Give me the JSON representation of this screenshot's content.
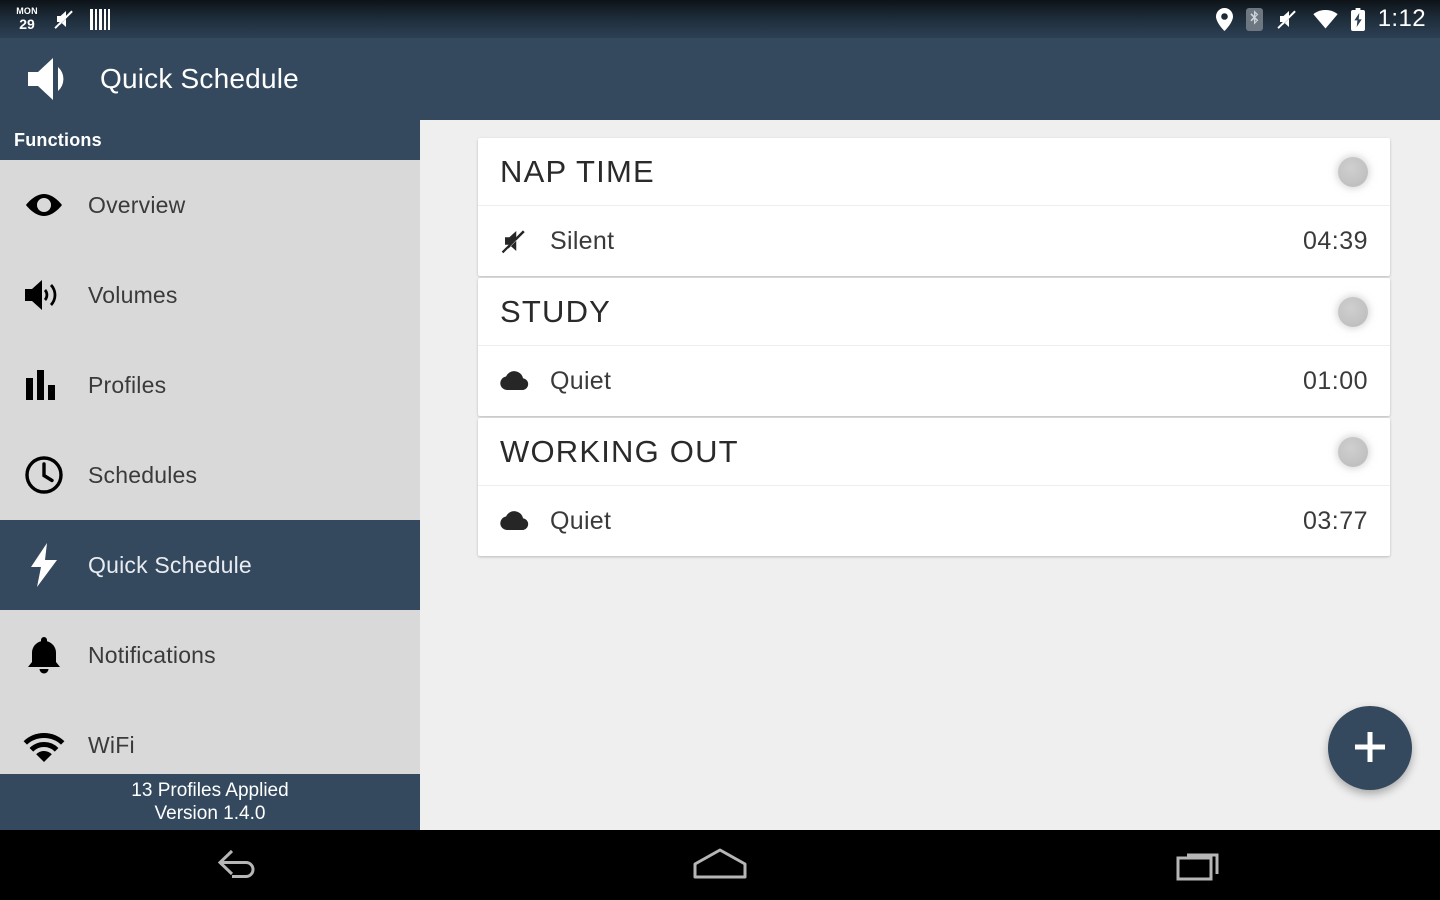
{
  "statusbar": {
    "calendar_month": "MON",
    "calendar_day": "29",
    "time": "1:12",
    "left_icons": [
      "calendar-icon",
      "volume-muted-icon",
      "barcode-icon"
    ],
    "right_icons": [
      "location-pin-icon",
      "bluetooth-icon",
      "volume-muted-icon",
      "wifi-icon",
      "battery-charging-icon"
    ]
  },
  "appbar": {
    "title": "Quick Schedule",
    "icon": "speaker-icon",
    "bg_color": "#34495e"
  },
  "sidebar": {
    "header": "Functions",
    "items": [
      {
        "label": "Overview",
        "icon": "eye-icon",
        "active": false
      },
      {
        "label": "Volumes",
        "icon": "speaker-waves-icon",
        "active": false
      },
      {
        "label": "Profiles",
        "icon": "bar-chart-icon",
        "active": false
      },
      {
        "label": "Schedules",
        "icon": "clock-icon",
        "active": false
      },
      {
        "label": "Quick Schedule",
        "icon": "lightning-bolt-icon",
        "active": true
      },
      {
        "label": "Notifications",
        "icon": "bell-icon",
        "active": false
      },
      {
        "label": "WiFi",
        "icon": "wifi-icon",
        "active": false
      }
    ],
    "footer": {
      "profiles_applied": "13 Profiles Applied",
      "version": "Version 1.4.0"
    }
  },
  "main": {
    "cards": [
      {
        "title": "NAP TIME",
        "toggle": "off",
        "row": {
          "icon": "volume-muted-icon",
          "label": "Silent",
          "time": "04:39"
        }
      },
      {
        "title": "STUDY",
        "toggle": "off",
        "row": {
          "icon": "cloud-icon",
          "label": "Quiet",
          "time": "01:00"
        }
      },
      {
        "title": "WORKING OUT",
        "toggle": "off",
        "row": {
          "icon": "cloud-icon",
          "label": "Quiet",
          "time": "03:77"
        }
      }
    ],
    "fab": {
      "icon": "plus-icon",
      "label": "+"
    },
    "bg_color": "#efefef"
  },
  "navbar": {
    "buttons": [
      {
        "name": "back",
        "icon": "back-arrow-icon"
      },
      {
        "name": "home",
        "icon": "home-icon"
      },
      {
        "name": "recents",
        "icon": "recents-icon"
      }
    ]
  }
}
